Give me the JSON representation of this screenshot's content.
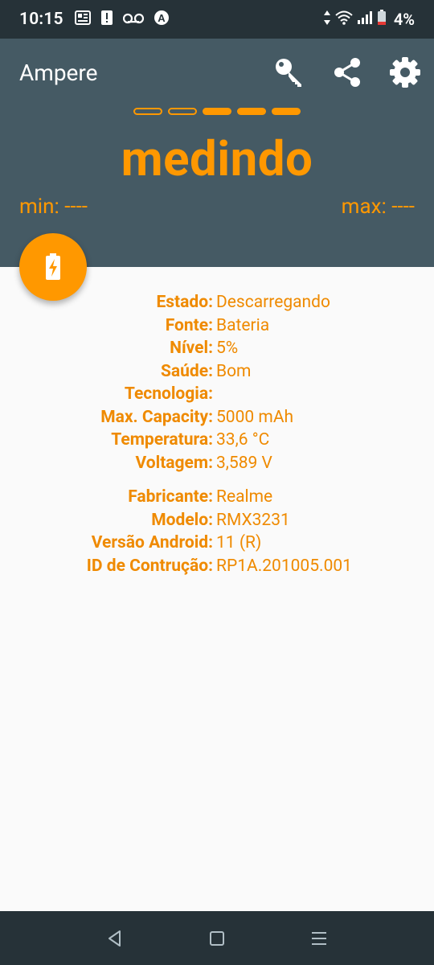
{
  "status_bar": {
    "time": "10:15",
    "battery_percent": "4%",
    "icons": [
      "news-icon",
      "alert-icon",
      "voicemail-icon",
      "auto-icon"
    ]
  },
  "app": {
    "title": "Ampere",
    "actions": [
      "key-icon",
      "share-icon",
      "settings-icon"
    ]
  },
  "measurement": {
    "state": "medindo",
    "progress_steps_total": 5,
    "progress_steps_filled": 3,
    "min_label": "min: ----",
    "max_label": "max: ----"
  },
  "battery_info": [
    {
      "label": "Estado:",
      "value": "Descarregando"
    },
    {
      "label": "Fonte:",
      "value": "Bateria"
    },
    {
      "label": "Nível:",
      "value": "5%"
    },
    {
      "label": "Saúde:",
      "value": "Bom"
    },
    {
      "label": "Tecnologia:",
      "value": ""
    },
    {
      "label": "Max. Capacity:",
      "value": "5000 mAh"
    },
    {
      "label": "Temperatura:",
      "value": "33,6 °C"
    },
    {
      "label": "Voltagem:",
      "value": "3,589 V"
    }
  ],
  "device_info": [
    {
      "label": "Fabricante:",
      "value": "Realme"
    },
    {
      "label": "Modelo:",
      "value": "RMX3231"
    },
    {
      "label": "Versão Android:",
      "value": "11 (R)"
    },
    {
      "label": "ID de Contrução:",
      "value": "RP1A.201005.001"
    }
  ],
  "colors": {
    "accent": "#ff9800",
    "header": "#455a64",
    "status_bar": "#263238",
    "background": "#fafafa"
  }
}
